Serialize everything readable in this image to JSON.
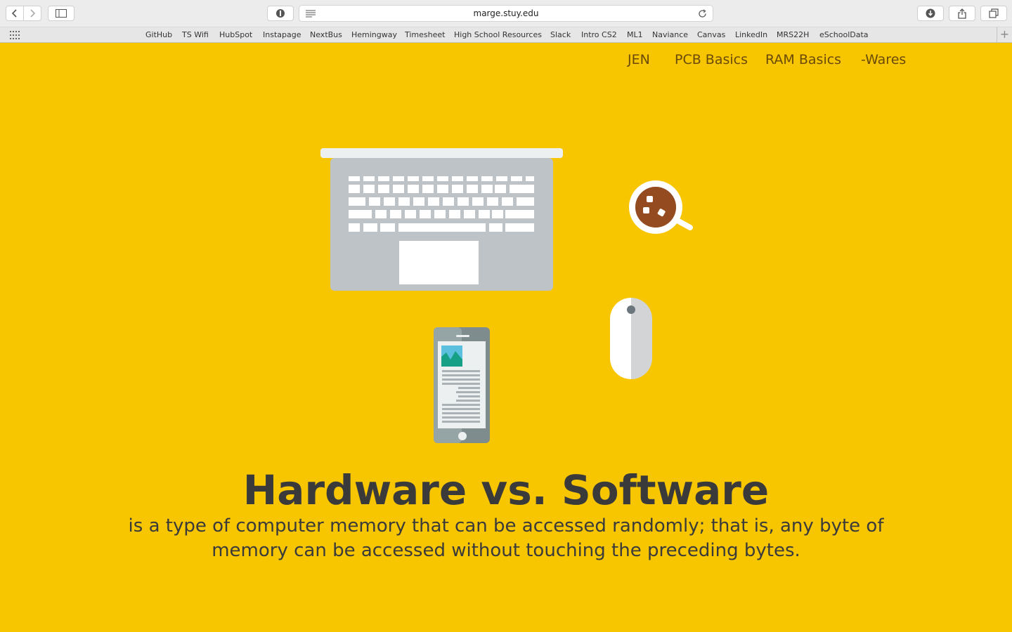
{
  "browser": {
    "url": "marge.stuy.edu",
    "bookmarks": [
      "GitHub",
      "TS Wifi",
      "HubSpot",
      "Instapage",
      "NextBus",
      "Hemingway",
      "Timesheet",
      "High School Resources",
      "Slack",
      "Intro CS2",
      "ML1",
      "Naviance",
      "Canvas",
      "LinkedIn",
      "MRS22H",
      "eSchoolData"
    ],
    "add_label": "+"
  },
  "nav": {
    "items": [
      "JEN",
      "PCB Basics",
      "RAM Basics",
      "-Wares"
    ]
  },
  "hero": {
    "title": "Hardware vs. Software",
    "subtitle": "is a type of computer memory that can be accessed randomly; that is, any byte of memory can be accessed without touching the preceding bytes."
  },
  "colors": {
    "background": "#f7c600",
    "text": "#3a3a3a",
    "nav": "#6a4a08"
  }
}
